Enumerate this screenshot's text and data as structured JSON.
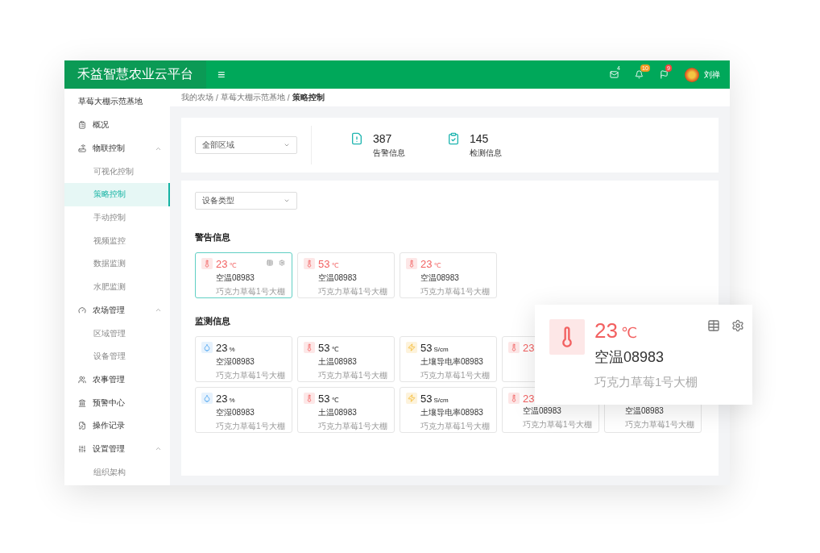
{
  "header": {
    "brand": "禾益智慧农业云平台",
    "menu_glyph": "≡",
    "notifications": [
      {
        "count": "4",
        "color": "#00a85a"
      },
      {
        "count": "10",
        "color": "#f59a23"
      },
      {
        "count": "9",
        "color": "#f5463f"
      }
    ],
    "user": "刘禅"
  },
  "sidebar": {
    "farm": "草莓大棚示范基地",
    "items": [
      {
        "label": "概况"
      },
      {
        "label": "物联控制",
        "expanded": true,
        "children": [
          {
            "label": "可视化控制",
            "selected": false
          },
          {
            "label": "策略控制",
            "selected": true
          },
          {
            "label": "手动控制",
            "selected": false
          },
          {
            "label": "视频监控",
            "selected": false
          },
          {
            "label": "数据监测",
            "selected": false
          },
          {
            "label": "水肥监测",
            "selected": false
          }
        ]
      },
      {
        "label": "农场管理",
        "expanded": true,
        "children": [
          {
            "label": "区域管理",
            "selected": false
          },
          {
            "label": "设备管理",
            "selected": false
          }
        ]
      },
      {
        "label": "农事管理"
      },
      {
        "label": "预警中心"
      },
      {
        "label": "操作记录"
      },
      {
        "label": "设置管理",
        "expanded": true,
        "children": [
          {
            "label": "组织架构",
            "selected": false
          }
        ]
      }
    ]
  },
  "breadcrumb": {
    "separator": "/",
    "items": [
      "我的农场",
      "草莓大棚示范基地",
      "策略控制"
    ]
  },
  "area_select": {
    "value": "全部区域"
  },
  "stats": [
    {
      "value": "387",
      "label": "告警信息"
    },
    {
      "value": "145",
      "label": "检测信息"
    }
  ],
  "type_select": {
    "value": "设备类型"
  },
  "warning": {
    "title": "警告信息",
    "cards": [
      {
        "kind": "temperature",
        "value": "23",
        "unit": "℃",
        "name": "空温08983",
        "location": "巧克力草莓1号大棚",
        "selected": true
      },
      {
        "kind": "temperature",
        "value": "53",
        "unit": "℃",
        "name": "空温08983",
        "location": "巧克力草莓1号大棚",
        "selected": false
      },
      {
        "kind": "temperature",
        "value": "23",
        "unit": "℃",
        "name": "空温08983",
        "location": "巧克力草莓1号大棚",
        "selected": false
      }
    ]
  },
  "monitor": {
    "title": "监测信息",
    "rows": [
      [
        {
          "kind": "humidity",
          "value": "23",
          "unit": "%",
          "name": "空湿08983",
          "location": "巧克力草莓1号大棚"
        },
        {
          "kind": "soil-temp",
          "value": "53",
          "unit": "℃",
          "name": "土温08983",
          "location": "巧克力草莓1号大棚"
        },
        {
          "kind": "conductivity",
          "value": "53",
          "unit": "S/cm",
          "name": "土壤导电率08983",
          "location": "巧克力草莓1号大棚"
        },
        {
          "kind": "temperature",
          "value": "23"
        }
      ],
      [
        {
          "kind": "humidity",
          "value": "23",
          "unit": "%",
          "name": "空湿08983",
          "location": "巧克力草莓1号大棚"
        },
        {
          "kind": "soil-temp",
          "value": "53",
          "unit": "℃",
          "name": "土温08983",
          "location": "巧克力草莓1号大棚"
        },
        {
          "kind": "conductivity",
          "value": "53",
          "unit": "S/cm",
          "name": "土壤导电率08983",
          "location": "巧克力草莓1号大棚"
        },
        {
          "kind": "temperature",
          "value": "23",
          "name": "空温08983",
          "location": "巧克力草莓1号大棚"
        },
        {
          "kind": "blank",
          "name": "空温08983",
          "location": "巧克力草莓1号大棚"
        }
      ]
    ]
  },
  "popup": {
    "kind": "temperature",
    "value": "23",
    "unit": "℃",
    "name": "空温08983",
    "location": "巧克力草莓1号大棚"
  }
}
